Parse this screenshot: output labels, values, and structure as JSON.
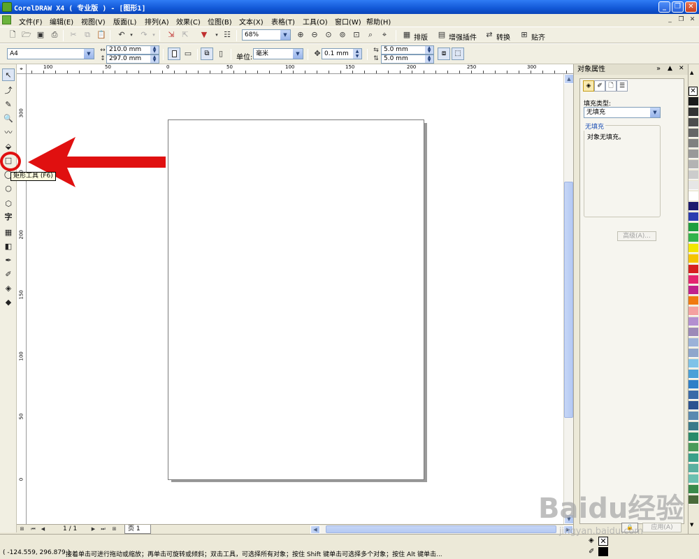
{
  "window": {
    "title": "CorelDRAW X4 ( 专业版 ) - [图形1]"
  },
  "menu": [
    "文件(F)",
    "编辑(E)",
    "视图(V)",
    "版面(L)",
    "排列(A)",
    "效果(C)",
    "位图(B)",
    "文本(X)",
    "表格(T)",
    "工具(O)",
    "窗口(W)",
    "帮助(H)"
  ],
  "standard_toolbar": {
    "zoom": "68%",
    "buttons": [
      "排版",
      "增强插件",
      "转换",
      "贴齐"
    ]
  },
  "property_bar": {
    "paper": "A4",
    "width": "210.0 mm",
    "height": "297.0 mm",
    "unit_label": "单位:",
    "unit": "毫米",
    "nudge": "0.1 mm",
    "dup_x": "5.0 mm",
    "dup_y": "5.0 mm"
  },
  "ruler": {
    "h_labels": [
      "100",
      "50",
      "0",
      "50",
      "100",
      "150",
      "200",
      "250",
      "300"
    ],
    "v_labels": [
      "300",
      "250",
      "200",
      "150",
      "100",
      "50",
      "0"
    ],
    "corner": "⌖"
  },
  "tooltip": "矩形工具 (F6)",
  "page_nav": {
    "counter": "1 / 1",
    "page_tab": "页 1"
  },
  "status": {
    "coords": "( -124.559, 296.879 )",
    "hint": "接着单击可进行拖动或缩放；再单击可旋转或倾斜；双击工具，可选择所有对象；按住 Shift 键单击可选择多个对象；按住 Alt 键单击..."
  },
  "docker": {
    "title": "对象属性",
    "fill_type_label": "填充类型:",
    "fill_type": "无填充",
    "group_title": "无填充",
    "description": "对象无填充。",
    "advanced": "高级(A)...",
    "apply": "应用(A)"
  },
  "watermark": {
    "brand": "Baidu经验",
    "url": "jingyan.baidu.com"
  },
  "colors": {
    "accent": "#e01010",
    "titlebar": "#1257d6",
    "palette": [
      "#1a1a1a",
      "#333333",
      "#4d4d4d",
      "#666666",
      "#808080",
      "#999999",
      "#b3b3b3",
      "#cccccc",
      "#e6e6e6",
      "#ffffff",
      "#1c1a6e",
      "#2b3bb0",
      "#1e9e3e",
      "#33b34b",
      "#f2e600",
      "#f5c400",
      "#d62020",
      "#e4256f",
      "#c0218c",
      "#f07a10",
      "#f4a0a0",
      "#b38fd0",
      "#9c8ab8",
      "#9cb2d8",
      "#8fa6cc",
      "#7fc2e8",
      "#4aa0d8",
      "#2e7fc8",
      "#3a6aa8",
      "#2a5290",
      "#5a8ab0",
      "#3a7a8a",
      "#2a8a6a",
      "#4a9a5a",
      "#3aa08a",
      "#5ab0a0",
      "#6ac0b0",
      "#3a8a4a",
      "#4a6a3a"
    ]
  }
}
